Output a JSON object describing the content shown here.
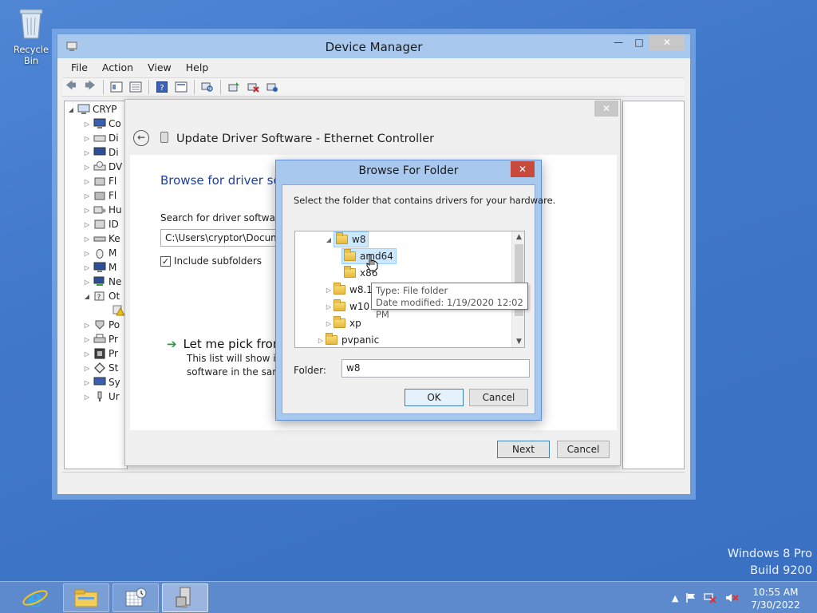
{
  "desktop": {
    "recycle_bin": "Recycle Bin",
    "watermark": {
      "line1": "Windows 8 Pro",
      "line2": "Build 9200"
    }
  },
  "device_manager": {
    "title": "Device Manager",
    "menu": [
      "File",
      "Action",
      "View",
      "Help"
    ],
    "tree_root": "CRYP",
    "tree_items": [
      "Co",
      "Di",
      "Di",
      "DV",
      "Fl",
      "Fl",
      "Hu",
      "ID",
      "Ke",
      "M",
      "M",
      "Ne",
      "Ot",
      "",
      "Po",
      "Pr",
      "Pr",
      "St",
      "Sy",
      "Ur"
    ]
  },
  "update_driver": {
    "title": "Update Driver Software - Ethernet Controller",
    "heading": "Browse for driver sof",
    "search_label": "Search for driver software in",
    "path_value": "C:\\Users\\cryptor\\Documen",
    "include_subfolders": "Include subfolders",
    "pick_title": "Let me pick from",
    "pick_desc_1": "This list will show inst",
    "pick_desc_2": "software in the same",
    "next": "Next",
    "cancel": "Cancel"
  },
  "browse_folder": {
    "title": "Browse For Folder",
    "instruction": "Select the folder that contains drivers for your hardware.",
    "tree": {
      "w8": "w8",
      "amd64": "amd64",
      "x86": "x86",
      "w81": "w8.1",
      "w10": "w10",
      "xp": "xp",
      "pvpanic": "pvpanic"
    },
    "tooltip_type": "Type: File folder",
    "tooltip_modified": "Date modified: 1/19/2020 12:02 PM",
    "folder_label": "Folder:",
    "folder_value": "w8",
    "ok": "OK",
    "cancel": "Cancel"
  },
  "taskbar": {
    "time": "10:55 AM",
    "date": "7/30/2022"
  }
}
